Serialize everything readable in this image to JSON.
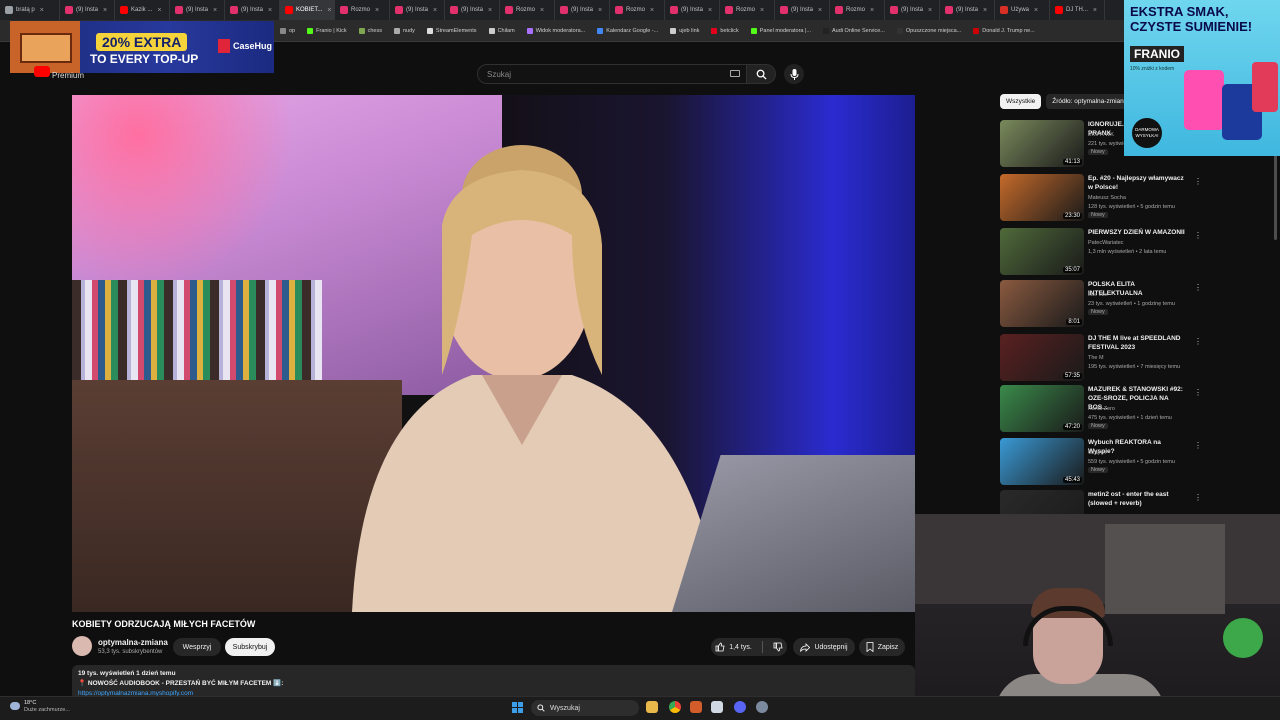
{
  "tabs": [
    {
      "label": "bratą p",
      "active": false,
      "color": "#9aa0a6"
    },
    {
      "label": "(9) Insta",
      "active": false,
      "color": "#e1306c"
    },
    {
      "label": "Kazik ...",
      "active": false,
      "color": "#ff0000"
    },
    {
      "label": "(9) Insta",
      "active": false,
      "color": "#e1306c"
    },
    {
      "label": "(9) Insta",
      "active": false,
      "color": "#e1306c"
    },
    {
      "label": "KOBIET...",
      "active": true,
      "color": "#ff0000"
    },
    {
      "label": "Rozmo",
      "active": false,
      "color": "#e1306c"
    },
    {
      "label": "(9) Insta",
      "active": false,
      "color": "#e1306c"
    },
    {
      "label": "(9) Insta",
      "active": false,
      "color": "#e1306c"
    },
    {
      "label": "Rozmo",
      "active": false,
      "color": "#e1306c"
    },
    {
      "label": "(9) Insta",
      "active": false,
      "color": "#e1306c"
    },
    {
      "label": "Rozmo",
      "active": false,
      "color": "#e1306c"
    },
    {
      "label": "(9) Insta",
      "active": false,
      "color": "#e1306c"
    },
    {
      "label": "Rozmo",
      "active": false,
      "color": "#e1306c"
    },
    {
      "label": "(9) Insta",
      "active": false,
      "color": "#e1306c"
    },
    {
      "label": "Rozmo",
      "active": false,
      "color": "#e1306c"
    },
    {
      "label": "(9) Insta",
      "active": false,
      "color": "#e1306c"
    },
    {
      "label": "(9) Insta",
      "active": false,
      "color": "#e1306c"
    },
    {
      "label": "Używa",
      "active": false,
      "color": "#d93025"
    },
    {
      "label": "DJ TH...",
      "active": false,
      "color": "#ff0000"
    }
  ],
  "bookmarks": [
    {
      "label": "op",
      "color": "#888888"
    },
    {
      "label": "Franio | Kick",
      "color": "#53fc18"
    },
    {
      "label": "chess",
      "color": "#7fa650"
    },
    {
      "label": "nudy",
      "color": "#aaaaaa"
    },
    {
      "label": "StreamElements",
      "color": "#dddddd"
    },
    {
      "label": "Chilam",
      "color": "#cccccc"
    },
    {
      "label": "Widok moderatora...",
      "color": "#a970ff"
    },
    {
      "label": "Kalendarz Google -...",
      "color": "#4285f4"
    },
    {
      "label": "ujeb link",
      "color": "#cccccc"
    },
    {
      "label": "betclick",
      "color": "#e2001a"
    },
    {
      "label": "Panel moderatora |...",
      "color": "#53fc18"
    },
    {
      "label": "Audi Online Service...",
      "color": "#222222"
    },
    {
      "label": "Opuszczone miejsca...",
      "color": "#333333"
    },
    {
      "label": "Donald J. Trump ne...",
      "color": "#cc0000"
    }
  ],
  "ad_top": {
    "pill": "20% EXTRA",
    "line": "TO EVERY TOP-UP",
    "logo": "CaseHug"
  },
  "youtube": {
    "premium": "Premium",
    "search_placeholder": "Szukaj"
  },
  "video": {
    "title": "KOBIETY ODRZUCAJĄ MIŁYCH FACETÓW",
    "channel": "optymalna-zmiana",
    "subscribers": "53,3 tys. subskrybentów",
    "support": "Wesprzyj",
    "subscribe": "Subskrybuj",
    "likes": "1,4 tys.",
    "share": "Udostępnij",
    "save": "Zapisz",
    "desc_meta": "19 tys. wyświetleń  1 dzień temu",
    "desc_line": "📍 NOWOŚĆ AUDIOBOOK - PRZESTAŃ BYĆ MIŁYM FACETEM ⬇️:",
    "desc_link": "https://optymalnazmiana.myshopify.com"
  },
  "chips": [
    "Wszystkie",
    "Źródło: optymalna-zmiana"
  ],
  "recommendations": [
    {
      "title": "IGNORUJE...\nPRANK",
      "channel": "EKIPA WK",
      "meta": "221 tys. wyświetleń",
      "duration": "41:13",
      "new": "Nowy",
      "thumb": "#7a8a5c"
    },
    {
      "title": "Ep. #20 - Najlepszy włamywacz w Polsce!",
      "channel": "Mateusz Socha",
      "meta": "128 tys. wyświetleń • 5 godzin temu",
      "duration": "23:30",
      "new": "Nowy",
      "thumb": "#c56a2a"
    },
    {
      "title": "PIERWSZY DZIEŃ W AMAZONII",
      "channel": "PatecWariatec",
      "meta": "1,3 mln wyświetleń • 2 lata temu",
      "duration": "35:07",
      "new": "",
      "thumb": "#4f6a3a"
    },
    {
      "title": "POLSKA ELITA INTELEKTUALNA",
      "channel": "ebe ebe",
      "meta": "23 tys. wyświetleń • 1 godzinę temu",
      "duration": "8:01",
      "new": "Nowy",
      "thumb": "#8a5a40"
    },
    {
      "title": "DJ THE M live at SPEEDLAND FESTIVAL 2023",
      "channel": "The M",
      "meta": "195 tys. wyświetleń • 7 miesięcy temu",
      "duration": "57:35",
      "new": "",
      "thumb": "#5a2020"
    },
    {
      "title": "MAZUREK & STANOWSKI #92: OZE-SROZE, POLICJA NA BOS...",
      "channel": "Kanał Zero",
      "meta": "475 tys. wyświetleń • 1 dzień temu",
      "duration": "47:20",
      "new": "Nowy",
      "thumb": "#3a8a4a"
    },
    {
      "title": "Wybuch REAKTORA na Wyspie?",
      "channel": "Czajnik",
      "meta": "559 tys. wyświetleń • 5 godzin temu",
      "duration": "45:43",
      "new": "Nowy",
      "thumb": "#3a9ad6"
    },
    {
      "title": "metin2 ost - enter the east (slowed + reverb)",
      "channel": "",
      "meta": "",
      "duration": "",
      "new": "",
      "thumb": "#2a2a2a"
    }
  ],
  "promo": {
    "headline": "EKSTRA SMAK,\nCZYSTE SUMIENIE!",
    "brand": "FRANIO",
    "sub": "10% zniżki z kodem",
    "badge": "DARMOWA WYSYŁKA!"
  },
  "taskbar": {
    "temp": "18°C",
    "weather": "Duże zachmurze...",
    "search": "Wyszukaj"
  }
}
